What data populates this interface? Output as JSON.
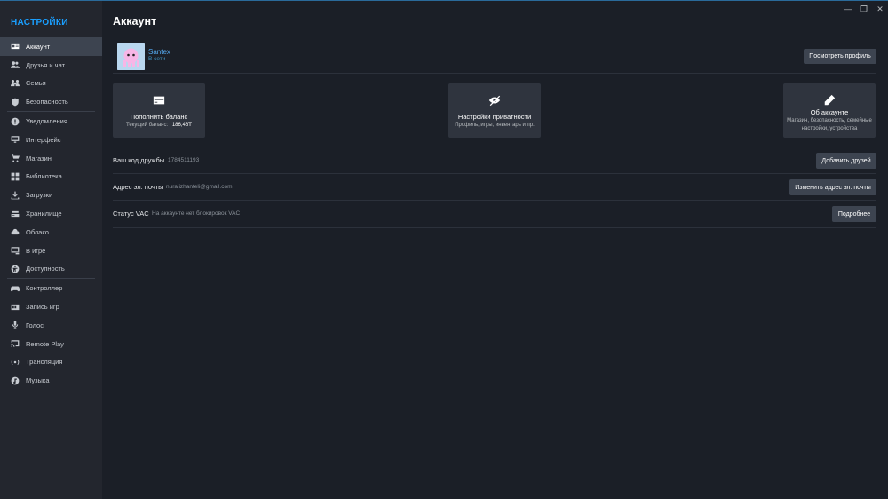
{
  "sidebar": {
    "title": "НАСТРОЙКИ",
    "items": [
      {
        "label": "Аккаунт",
        "icon": "id-card-icon",
        "active": true
      },
      {
        "label": "Друзья и чат",
        "icon": "friends-icon"
      },
      {
        "label": "Семья",
        "icon": "family-icon"
      },
      {
        "label": "Безопасность",
        "icon": "shield-icon"
      },
      {
        "label": "Уведомления",
        "icon": "alert-icon"
      },
      {
        "label": "Интерфейс",
        "icon": "monitor-icon"
      },
      {
        "label": "Магазин",
        "icon": "cart-icon"
      },
      {
        "label": "Библиотека",
        "icon": "grid-icon"
      },
      {
        "label": "Загрузки",
        "icon": "download-icon"
      },
      {
        "label": "Хранилище",
        "icon": "storage-icon"
      },
      {
        "label": "Облако",
        "icon": "cloud-icon"
      },
      {
        "label": "В игре",
        "icon": "in-game-icon"
      },
      {
        "label": "Доступность",
        "icon": "accessibility-icon"
      },
      {
        "label": "Контроллер",
        "icon": "gamepad-icon"
      },
      {
        "label": "Запись игр",
        "icon": "record-icon"
      },
      {
        "label": "Голос",
        "icon": "microphone-icon"
      },
      {
        "label": "Remote Play",
        "icon": "cast-icon"
      },
      {
        "label": "Трансляция",
        "icon": "broadcast-icon"
      },
      {
        "label": "Музыка",
        "icon": "music-icon"
      }
    ]
  },
  "window": {
    "minimize": "—",
    "restore": "❐",
    "close": "✕"
  },
  "main": {
    "title": "Аккаунт",
    "profile": {
      "name": "Santex",
      "status": "В сети",
      "view_profile_label": "Посмотреть профиль"
    },
    "cards": [
      {
        "title": "Пополнить баланс",
        "subtitle_label": "Текущий баланс:",
        "subtitle_value": "186,46₸",
        "icon": "wallet-icon"
      },
      {
        "title": "Настройки приватности",
        "subtitle": "Профиль, игры, инвентарь и пр.",
        "icon": "eye-off-icon"
      },
      {
        "title": "Об аккаунте",
        "subtitle": "Магазин, безопасность, семейные настройки, устройства",
        "icon": "pencil-icon"
      }
    ],
    "rows": [
      {
        "label": "Ваш код дружбы",
        "value": "1784511193",
        "button": "Добавить друзей"
      },
      {
        "label": "Адрес эл. почты",
        "value": "nuralizhanteli@gmail.com",
        "button": "Изменить адрес эл. почты"
      },
      {
        "label": "Статус VAC",
        "value": "На аккаунте нет блокировок VAC",
        "button": "Подробнее"
      }
    ]
  },
  "colors": {
    "accent": "#1a9fff",
    "sidebar_bg": "#23262e",
    "main_bg": "#1b1f27",
    "button_bg": "#3d4450",
    "card_bg": "#2f343e"
  }
}
